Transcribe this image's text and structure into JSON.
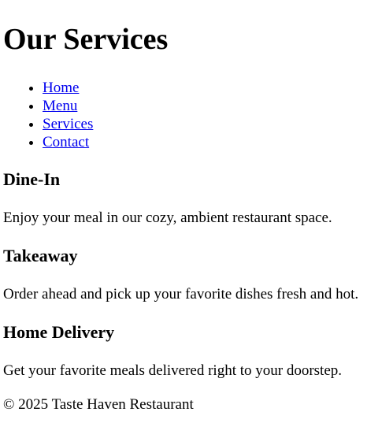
{
  "header": {
    "title": "Our Services"
  },
  "nav": {
    "items": [
      {
        "label": "Home"
      },
      {
        "label": "Menu"
      },
      {
        "label": "Services"
      },
      {
        "label": "Contact"
      }
    ]
  },
  "services": [
    {
      "title": "Dine-In",
      "description": "Enjoy your meal in our cozy, ambient restaurant space."
    },
    {
      "title": "Takeaway",
      "description": "Order ahead and pick up your favorite dishes fresh and hot."
    },
    {
      "title": "Home Delivery",
      "description": "Get your favorite meals delivered right to your doorstep."
    }
  ],
  "footer": {
    "text": "© 2025 Taste Haven Restaurant"
  },
  "colors": {
    "link": "#0000ee",
    "text": "#000000",
    "background": "#ffffff"
  }
}
